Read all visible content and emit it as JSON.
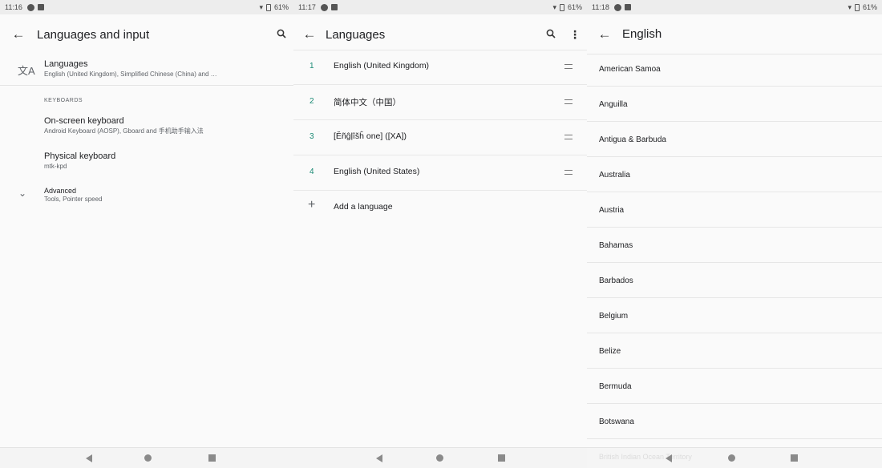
{
  "screen1": {
    "status": {
      "time": "11:16",
      "battery": "61%"
    },
    "appbar": {
      "back_icon": "arrow-left-icon",
      "title": "Languages and input",
      "search_icon": "search-icon"
    },
    "languages": {
      "icon": "translate-icon",
      "title": "Languages",
      "subtitle": "English (United Kingdom), Simplified Chinese (China) and …"
    },
    "keyboards_header": "KEYBOARDS",
    "onscreen": {
      "title": "On-screen keyboard",
      "subtitle": "Android Keyboard (AOSP), Gboard and 手机助手输入法"
    },
    "physical": {
      "title": "Physical keyboard",
      "subtitle": "mtk-kpd"
    },
    "advanced": {
      "icon": "chevron-down-icon",
      "title": "Advanced",
      "subtitle": "Tools, Pointer speed"
    }
  },
  "screen2": {
    "status": {
      "time": "11:17",
      "battery": "61%"
    },
    "appbar": {
      "back_icon": "arrow-left-icon",
      "title": "Languages",
      "search_icon": "search-icon",
      "more_icon": "more-vert-icon"
    },
    "languages": [
      {
        "num": "1",
        "name": "English (United Kingdom)"
      },
      {
        "num": "2",
        "name": "简体中文（中国）"
      },
      {
        "num": "3",
        "name": "[Ĕñĝļîšĥ one] ([XA])"
      },
      {
        "num": "4",
        "name": "English (United States)"
      }
    ],
    "add_language": "Add a language"
  },
  "screen3": {
    "status": {
      "time": "11:18",
      "battery": "61%"
    },
    "appbar": {
      "back_icon": "arrow-left-icon",
      "title": "English"
    },
    "countries": [
      "American Samoa",
      "Anguilla",
      "Antigua & Barbuda",
      "Australia",
      "Austria",
      "Bahamas",
      "Barbados",
      "Belgium",
      "Belize",
      "Bermuda",
      "Botswana"
    ],
    "faded_next": "British Indian Ocean Territory"
  },
  "colors": {
    "accent": "#1a8a74",
    "background": "#fafafa",
    "statusbar": "#ededed"
  }
}
